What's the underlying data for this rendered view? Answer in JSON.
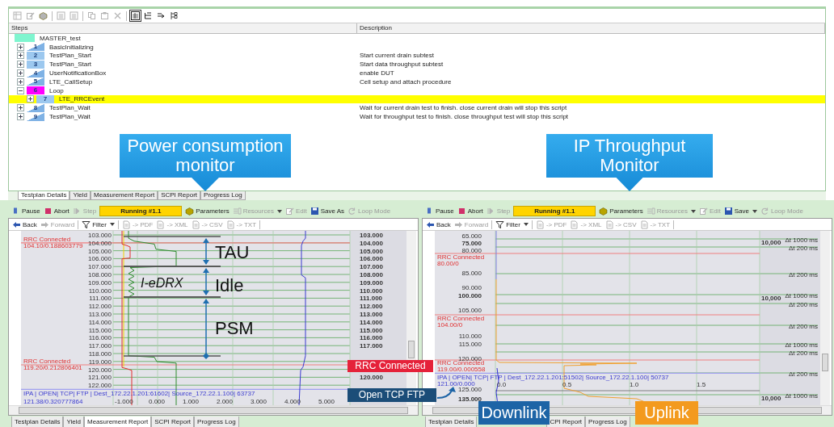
{
  "toolbar": [
    {
      "kind": "icon",
      "disabled": true,
      "selected": false
    },
    {
      "kind": "icon",
      "disabled": true,
      "selected": false
    },
    {
      "kind": "icon",
      "disabled": true,
      "selected": false
    },
    {
      "kind": "separator"
    },
    {
      "kind": "icon",
      "disabled": true,
      "selected": false
    },
    {
      "kind": "icon",
      "disabled": true,
      "selected": false
    },
    {
      "kind": "separator"
    },
    {
      "kind": "icon",
      "disabled": true,
      "selected": false
    },
    {
      "kind": "icon",
      "disabled": true,
      "selected": false
    },
    {
      "kind": "icon",
      "disabled": true,
      "selected": false
    },
    {
      "kind": "separator"
    },
    {
      "kind": "icon",
      "disabled": false,
      "selected": true
    },
    {
      "kind": "icon",
      "disabled": false,
      "selected": false
    },
    {
      "kind": "icon",
      "disabled": false,
      "selected": false
    },
    {
      "kind": "icon",
      "disabled": false,
      "selected": false
    }
  ],
  "steps": {
    "columns": [
      "Steps",
      "Description"
    ],
    "root": {
      "label": "MASTER_test",
      "color": "#7ff5cf"
    },
    "items": [
      {
        "number": "1",
        "label": "BasicInitializing",
        "kind": "wedge",
        "color": "#7fb2e5",
        "expanded": false,
        "selected": false
      },
      {
        "number": "2",
        "label": "TestPlan_Start",
        "kind": "block",
        "color": "#9cc8ef",
        "expanded": false,
        "selected": false,
        "description": "Start current drain subtest"
      },
      {
        "number": "3",
        "label": "TestPlan_Start",
        "kind": "block",
        "color": "#9cc8ef",
        "expanded": false,
        "selected": false,
        "description": "Start data throughput subtest"
      },
      {
        "number": "4",
        "label": "UserNotificationBox",
        "kind": "wedge",
        "color": "#7fb2e5",
        "expanded": false,
        "selected": false,
        "description": "enable DUT"
      },
      {
        "number": "5",
        "label": "LTE_CallSetup",
        "kind": "wedge",
        "color": "#7fb2e5",
        "expanded": false,
        "selected": false,
        "description": "Cell setup and attach procedure"
      },
      {
        "number": "6",
        "label": "Loop",
        "kind": "block",
        "color": "#ff00ff",
        "expanded": true,
        "selected": false,
        "children": [
          {
            "number": "7",
            "label": "LTE_RRCEvent",
            "kind": "block",
            "color": "#9cc8ef",
            "expanded": false,
            "selected": true
          }
        ]
      },
      {
        "number": "8",
        "label": "TestPlan_Wait",
        "kind": "wedge",
        "color": "#7fb2e5",
        "expanded": false,
        "selected": false,
        "description": "Wait for current drain test to finish. close current drain will stop this script"
      },
      {
        "number": "9",
        "label": "TestPlan_Wait",
        "kind": "wedge",
        "color": "#7fb2e5",
        "expanded": false,
        "selected": false,
        "description": "Wait for throughput test to finish. close throughput test will stop this script"
      }
    ]
  },
  "callouts": [
    {
      "text": "Power consumption monitor"
    },
    {
      "text": "IP Throughput Monitor"
    }
  ],
  "top_tabs": [
    {
      "label": "Testplan Details",
      "selected": true
    },
    {
      "label": "Yield",
      "selected": false
    },
    {
      "label": "Measurement Report",
      "selected": false
    },
    {
      "label": "SCPI Report",
      "selected": false
    },
    {
      "label": "Progress Log",
      "selected": false
    }
  ],
  "panels": [
    {
      "toolbar": [
        {
          "kind": "button",
          "label": "Pause",
          "disabled": false
        },
        {
          "kind": "button",
          "label": "Abort",
          "disabled": false
        },
        {
          "kind": "button",
          "label": "Step",
          "disabled": true
        },
        {
          "kind": "status",
          "label": "Running #1.1"
        },
        {
          "kind": "button",
          "label": "Parameters",
          "disabled": false
        },
        {
          "kind": "button",
          "label": "Resources",
          "disabled": true,
          "dropdown": true
        },
        {
          "kind": "button",
          "label": "Edit",
          "disabled": true
        },
        {
          "kind": "button",
          "label": "Save As",
          "disabled": false
        },
        {
          "kind": "button",
          "label": "Loop Mode",
          "disabled": true
        }
      ],
      "nav": [
        {
          "label": "Back",
          "disabled": false
        },
        {
          "label": "Forward",
          "disabled": true
        },
        {
          "label": "Filter",
          "disabled": false,
          "dropdown": true
        },
        {
          "label": "-> PDF",
          "disabled": true
        },
        {
          "label": "-> XML",
          "disabled": true
        },
        {
          "label": "-> CSV",
          "disabled": true
        },
        {
          "label": "-> TXT",
          "disabled": true
        }
      ],
      "chart": {
        "y_labels": [
          {
            "text": "103.000",
            "bold": false
          },
          {
            "text": "104.000",
            "bold": false
          },
          {
            "text": "105.000",
            "bold": false
          },
          {
            "text": "106.000",
            "bold": false
          },
          {
            "text": "107.000",
            "bold": false
          },
          {
            "text": "108.000",
            "bold": false
          },
          {
            "text": "109.000",
            "bold": false
          },
          {
            "text": "110.000",
            "bold": false
          },
          {
            "text": "111.000",
            "bold": false
          },
          {
            "text": "112.000",
            "bold": false
          },
          {
            "text": "113.000",
            "bold": false
          },
          {
            "text": "114.000",
            "bold": false
          },
          {
            "text": "115.000",
            "bold": false
          },
          {
            "text": "116.000",
            "bold": false
          },
          {
            "text": "117.000",
            "bold": false
          },
          {
            "text": "118.000",
            "bold": false
          },
          {
            "text": "119.000",
            "bold": false
          },
          {
            "text": "120.000",
            "bold": false
          },
          {
            "text": "121.000",
            "bold": false
          },
          {
            "text": "122.000",
            "bold": false
          }
        ],
        "right_labels": [
          {
            "value": "103.000"
          },
          {
            "value": "104.000"
          },
          {
            "value": "105.000"
          },
          {
            "value": "106.000"
          },
          {
            "value": "107.000"
          },
          {
            "value": "108.000"
          },
          {
            "value": "109.000"
          },
          {
            "value": "110.000"
          },
          {
            "value": "111.000"
          },
          {
            "value": "112.000"
          },
          {
            "value": "113.000"
          },
          {
            "value": "114.000"
          },
          {
            "value": "115.000"
          },
          {
            "value": "116.000"
          },
          {
            "value": "117.000"
          },
          {
            "value": "120.000"
          }
        ],
        "x_labels": [
          "-1.000",
          "0.000",
          "1.000",
          "2.000",
          "3.000",
          "4.000",
          "5.000"
        ],
        "events": [
          {
            "kind": "rrc",
            "label": "RRC Connected",
            "value": "104.10/0.188603779"
          },
          {
            "kind": "rrc",
            "label": "RRC Connected",
            "value": "119.20/0.212806401"
          },
          {
            "kind": "ip",
            "label": "IPA | OPEN| TCP| FTP | Dest_172.22.1.201:61602| Source_172.22.1.100| 63737",
            "value": "121.38/0.320777864"
          }
        ],
        "annotations": [
          {
            "kind": "phase",
            "text": "TAU"
          },
          {
            "kind": "note",
            "text": "I-eDRX"
          },
          {
            "kind": "phase",
            "text": "Idle"
          },
          {
            "kind": "phase",
            "text": "PSM"
          }
        ]
      },
      "tabs": [
        {
          "label": "Testplan Details",
          "selected": false
        },
        {
          "label": "Yield",
          "selected": false
        },
        {
          "label": "Measurement Report",
          "selected": true
        },
        {
          "label": "SCPI Report",
          "selected": false
        },
        {
          "label": "Progress Log",
          "selected": false
        }
      ]
    },
    {
      "toolbar": [
        {
          "kind": "button",
          "label": "Pause",
          "disabled": false
        },
        {
          "kind": "button",
          "label": "Abort",
          "disabled": false
        },
        {
          "kind": "button",
          "label": "Step",
          "disabled": true
        },
        {
          "kind": "status",
          "label": "Running #1.1"
        },
        {
          "kind": "button",
          "label": "Parameters",
          "disabled": false
        },
        {
          "kind": "button",
          "label": "Resources",
          "disabled": true,
          "dropdown": true
        },
        {
          "kind": "button",
          "label": "Edit",
          "disabled": true
        },
        {
          "kind": "button",
          "label": "Save",
          "disabled": false,
          "dropdown": true
        },
        {
          "kind": "button",
          "label": "Loop Mode",
          "disabled": true
        }
      ],
      "nav": [
        {
          "label": "Back",
          "disabled": false
        },
        {
          "label": "Forward",
          "disabled": true
        },
        {
          "label": "Filter",
          "disabled": false,
          "dropdown": true
        },
        {
          "label": "-> PDF",
          "disabled": true
        },
        {
          "label": "-> XML",
          "disabled": true
        },
        {
          "label": "-> CSV",
          "disabled": true
        },
        {
          "label": "-> TXT",
          "disabled": true
        }
      ],
      "chart": {
        "y_labels": [
          {
            "text": "65.000",
            "bold": false
          },
          {
            "text": "75.000",
            "bold": true
          },
          {
            "text": "80.000",
            "bold": false
          },
          {
            "text": "85.000",
            "bold": false
          },
          {
            "text": "90.000",
            "bold": false
          },
          {
            "text": "100.000",
            "bold": true
          },
          {
            "text": "105.000",
            "bold": false
          },
          {
            "text": "110.000",
            "bold": false
          },
          {
            "text": "115.000",
            "bold": false
          },
          {
            "text": "120.000",
            "bold": false
          },
          {
            "text": "125.000",
            "bold": false
          },
          {
            "text": "135.000",
            "bold": true
          }
        ],
        "right_labels": [
          {
            "value": "10,000",
            "delta": "Δt 1000 ms"
          },
          {
            "delta": "Δt 200 ms"
          },
          {
            "delta": "Δt 200 ms"
          },
          {
            "value": "10,000",
            "delta": "Δt 1000 ms"
          },
          {
            "delta": "Δt 200 ms"
          },
          {
            "delta": "Δt 200 ms"
          },
          {
            "delta": "Δt 1000 ms"
          },
          {
            "delta": "Δt 200 ms"
          },
          {
            "delta": "Δt 200 ms"
          },
          {
            "value": "10,000",
            "delta": "Δt 1000 ms"
          }
        ],
        "x_labels": [
          "0.0",
          "0.5",
          "1.0",
          "1.5"
        ],
        "events": [
          {
            "kind": "rrc",
            "label": "RRC Connected",
            "value": "80.00/0"
          },
          {
            "kind": "rrc",
            "label": "RRC Connected",
            "value": "104.00/0"
          },
          {
            "kind": "rrc",
            "label": "RRC Connected",
            "value": "119.00/0.000558"
          },
          {
            "kind": "ip",
            "label": "IPA | OPEN| TCP| FTP | Dest_172.22.1.201:51502| Source_172.22.1.100| 50737",
            "value": "121.00/0.000"
          }
        ]
      },
      "tabs": [
        {
          "label": "Testplan Details",
          "selected": false
        },
        {
          "label": "CPI Report",
          "selected": false
        },
        {
          "label": "Progress Log",
          "selected": false
        }
      ]
    }
  ],
  "overlays": [
    {
      "text": "RRC Connected",
      "color": "#e5223a"
    },
    {
      "text": "Open TCP FTP",
      "color": "#1b4d78"
    },
    {
      "text": "Downlink",
      "color": "#1d64a6"
    },
    {
      "text": "Uplink",
      "color": "#f39a1e"
    }
  ]
}
